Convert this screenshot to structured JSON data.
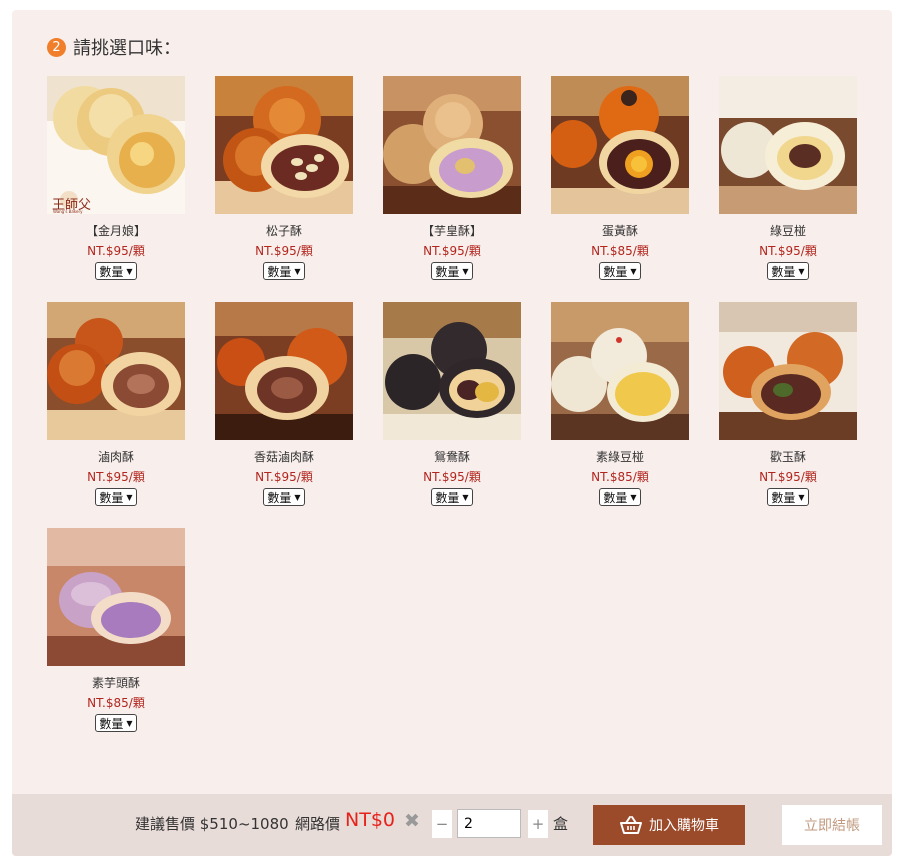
{
  "step": {
    "number": "2",
    "title": "請挑選口味："
  },
  "products": [
    {
      "name": "【金月娘】",
      "price": "NT.$95/顆",
      "qty_label": "數量",
      "logo_text": "王師父",
      "logo_sub": "Wang's Bakery"
    },
    {
      "name": "松子酥",
      "price": "NT.$95/顆",
      "qty_label": "數量"
    },
    {
      "name": "【芋皇酥】",
      "price": "NT.$95/顆",
      "qty_label": "數量"
    },
    {
      "name": "蛋黃酥",
      "price": "NT.$85/顆",
      "qty_label": "數量"
    },
    {
      "name": "綠豆椪",
      "price": "NT.$95/顆",
      "qty_label": "數量"
    },
    {
      "name": "滷肉酥",
      "price": "NT.$95/顆",
      "qty_label": "數量"
    },
    {
      "name": "香菇滷肉酥",
      "price": "NT.$95/顆",
      "qty_label": "數量"
    },
    {
      "name": "鴛鴦酥",
      "price": "NT.$95/顆",
      "qty_label": "數量"
    },
    {
      "name": "素綠豆椪",
      "price": "NT.$85/顆",
      "qty_label": "數量"
    },
    {
      "name": "歡玉酥",
      "price": "NT.$95/顆",
      "qty_label": "數量"
    },
    {
      "name": "素芋頭酥",
      "price": "NT.$85/顆",
      "qty_label": "數量"
    }
  ],
  "footer": {
    "suggested": "建議售價 $510~1080",
    "net_label": "網路價",
    "net_price": "NT$0",
    "reset": "✖",
    "minus": "−",
    "plus": "+",
    "quantity": "2",
    "unit": "盒",
    "add_to_cart": "加入購物車",
    "checkout": "立即結帳"
  },
  "colors": {
    "accent": "#f07e2a",
    "price": "#b2261e",
    "cart_button": "#9b4a2a",
    "net_price": "#e6211a"
  }
}
